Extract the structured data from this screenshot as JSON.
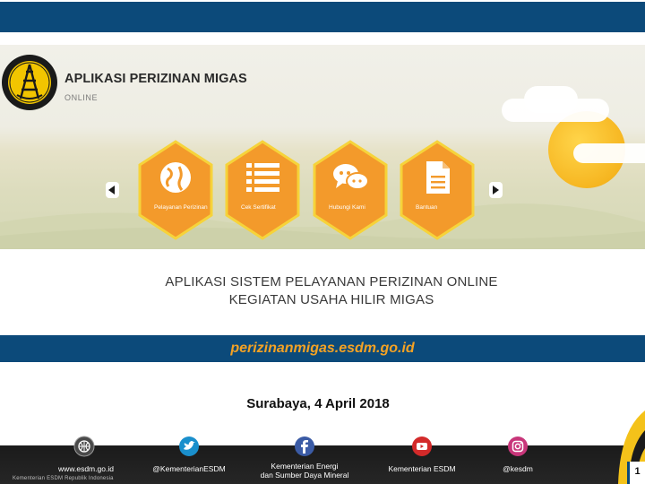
{
  "header": {
    "app_title": "APLIKASI PERIZINAN MIGAS",
    "app_subtitle": "ONLINE"
  },
  "menu": [
    {
      "label": "Pelayanan Perizinan",
      "icon": "globe-icon"
    },
    {
      "label": "Cek Sertifikat",
      "icon": "list-icon"
    },
    {
      "label": "Hubungi Kami",
      "icon": "chat-icon"
    },
    {
      "label": "Bantuan",
      "icon": "document-icon"
    }
  ],
  "main": {
    "title_line1": "APLIKASI SISTEM PELAYANAN PERIZINAN ONLINE",
    "title_line2": "KEGIATAN USAHA HILIR MIGAS",
    "url": "perizinanmigas.esdm.go.id",
    "date": "Surabaya, 4 April 2018"
  },
  "footer": {
    "website": "www.esdm.go.id",
    "twitter": "@KementerianESDM",
    "facebook_line1": "Kementerian Energi",
    "facebook_line2": "dan Sumber Daya Mineral",
    "youtube": "Kementerian ESDM",
    "instagram": "@kesdm",
    "copyright": "Kementerian ESDM Republik Indonesia",
    "page_number": "1"
  },
  "colors": {
    "navy": "#0c4a7a",
    "orange": "#f39a2b",
    "hex_border": "#f6d33a",
    "url_text": "#f4a224"
  }
}
